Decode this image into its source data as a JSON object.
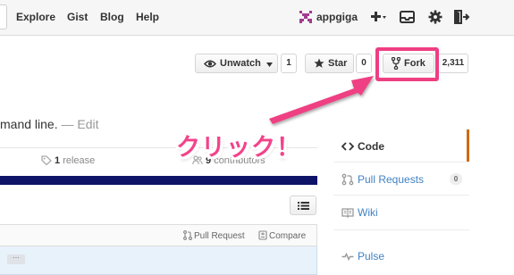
{
  "header": {
    "nav": [
      "Explore",
      "Gist",
      "Blog",
      "Help"
    ],
    "username": "appgiga",
    "icons": [
      "plus-icon",
      "inbox-icon",
      "gear-icon",
      "sign-out-icon"
    ]
  },
  "repo_actions": {
    "watch_label": "Unwatch",
    "watch_count": "1",
    "star_label": "Star",
    "star_count": "0",
    "fork_label": "Fork",
    "fork_count": "2,311"
  },
  "description": {
    "text": "mand line.",
    "separator": " — ",
    "edit_label": "Edit"
  },
  "summary": {
    "releases_count": "1",
    "releases_label": "release",
    "contributors_count": "9",
    "contributors_label": "contributors"
  },
  "file_header": {
    "pull_request_label": "Pull Request",
    "compare_label": "Compare"
  },
  "file_row": {
    "ellipsis": "···"
  },
  "sidebar": {
    "items": [
      {
        "label": "Code",
        "icon": "code-icon"
      },
      {
        "label": "Pull Requests",
        "icon": "pull-request-icon",
        "badge": "0"
      },
      {
        "label": "Wiki",
        "icon": "book-icon"
      },
      {
        "label": "Pulse",
        "icon": "pulse-icon"
      }
    ]
  },
  "annotation": {
    "callout": "クリック！",
    "color": "#ee3f82"
  },
  "colors": {
    "link": "#4183c4",
    "selected_accent": "#d26911",
    "language_bar": "#0e1368"
  }
}
